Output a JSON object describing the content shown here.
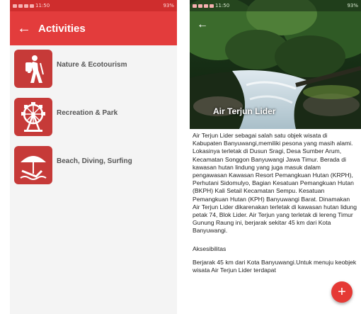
{
  "left": {
    "status_time": "11:50",
    "status_battery": "93%",
    "title": "Activities",
    "items": [
      {
        "label": "Nature & Ecotourism",
        "icon": "hiker-icon"
      },
      {
        "label": "Recreation & Park",
        "icon": "ferris-wheel-icon"
      },
      {
        "label": "Beach, Diving, Surfing",
        "icon": "beach-umbrella-icon"
      }
    ]
  },
  "right": {
    "status_time": "11:50",
    "status_battery": "93%",
    "place_title": "Air Terjun Lider",
    "description": "Air Terjun Lider sebagai salah satu objek wisata di Kabupaten Banyuwangi,memiliki pesona yang masih alami. Lokasinya terletak di Dusun Sragi, Desa Sumber Arum, Kecamatan Songgon Banyuwangi Jawa Timur. Berada di kawasan hutan lindung yang juga masuk dalam pengawasan Kawasan Resort Pemangkuan Hutan (KRPH), Perhutani Sidomulyo, Bagian Kesatuan Pemangkuan Hutan (BKPH) Kali Setail Kecamatan Sempu. Kesatuan Pemangkuan Hutan (KPH) Banyuwangi Barat. Dinamakan Air Terjun Lider dikarenakan terletak di kawasan hutan lidung petak 74, Blok Lider. Air Terjun yang terletak di lereng Timur Gunung Raung ini, berjarak sekitar 45 km dari Kota Banyuwangi.",
    "section_heading": "Aksesibilitas",
    "access_text": "Berjarak 45 km dari Kota Banyuwangi.Untuk menuju keobjek wisata Air Terjun Lider terdapat",
    "fab_label": "+"
  },
  "colors": {
    "appbar": "#e33c3c",
    "statusbar": "#cf2d2d",
    "tile": "#c63a38",
    "fab": "#e53935"
  }
}
